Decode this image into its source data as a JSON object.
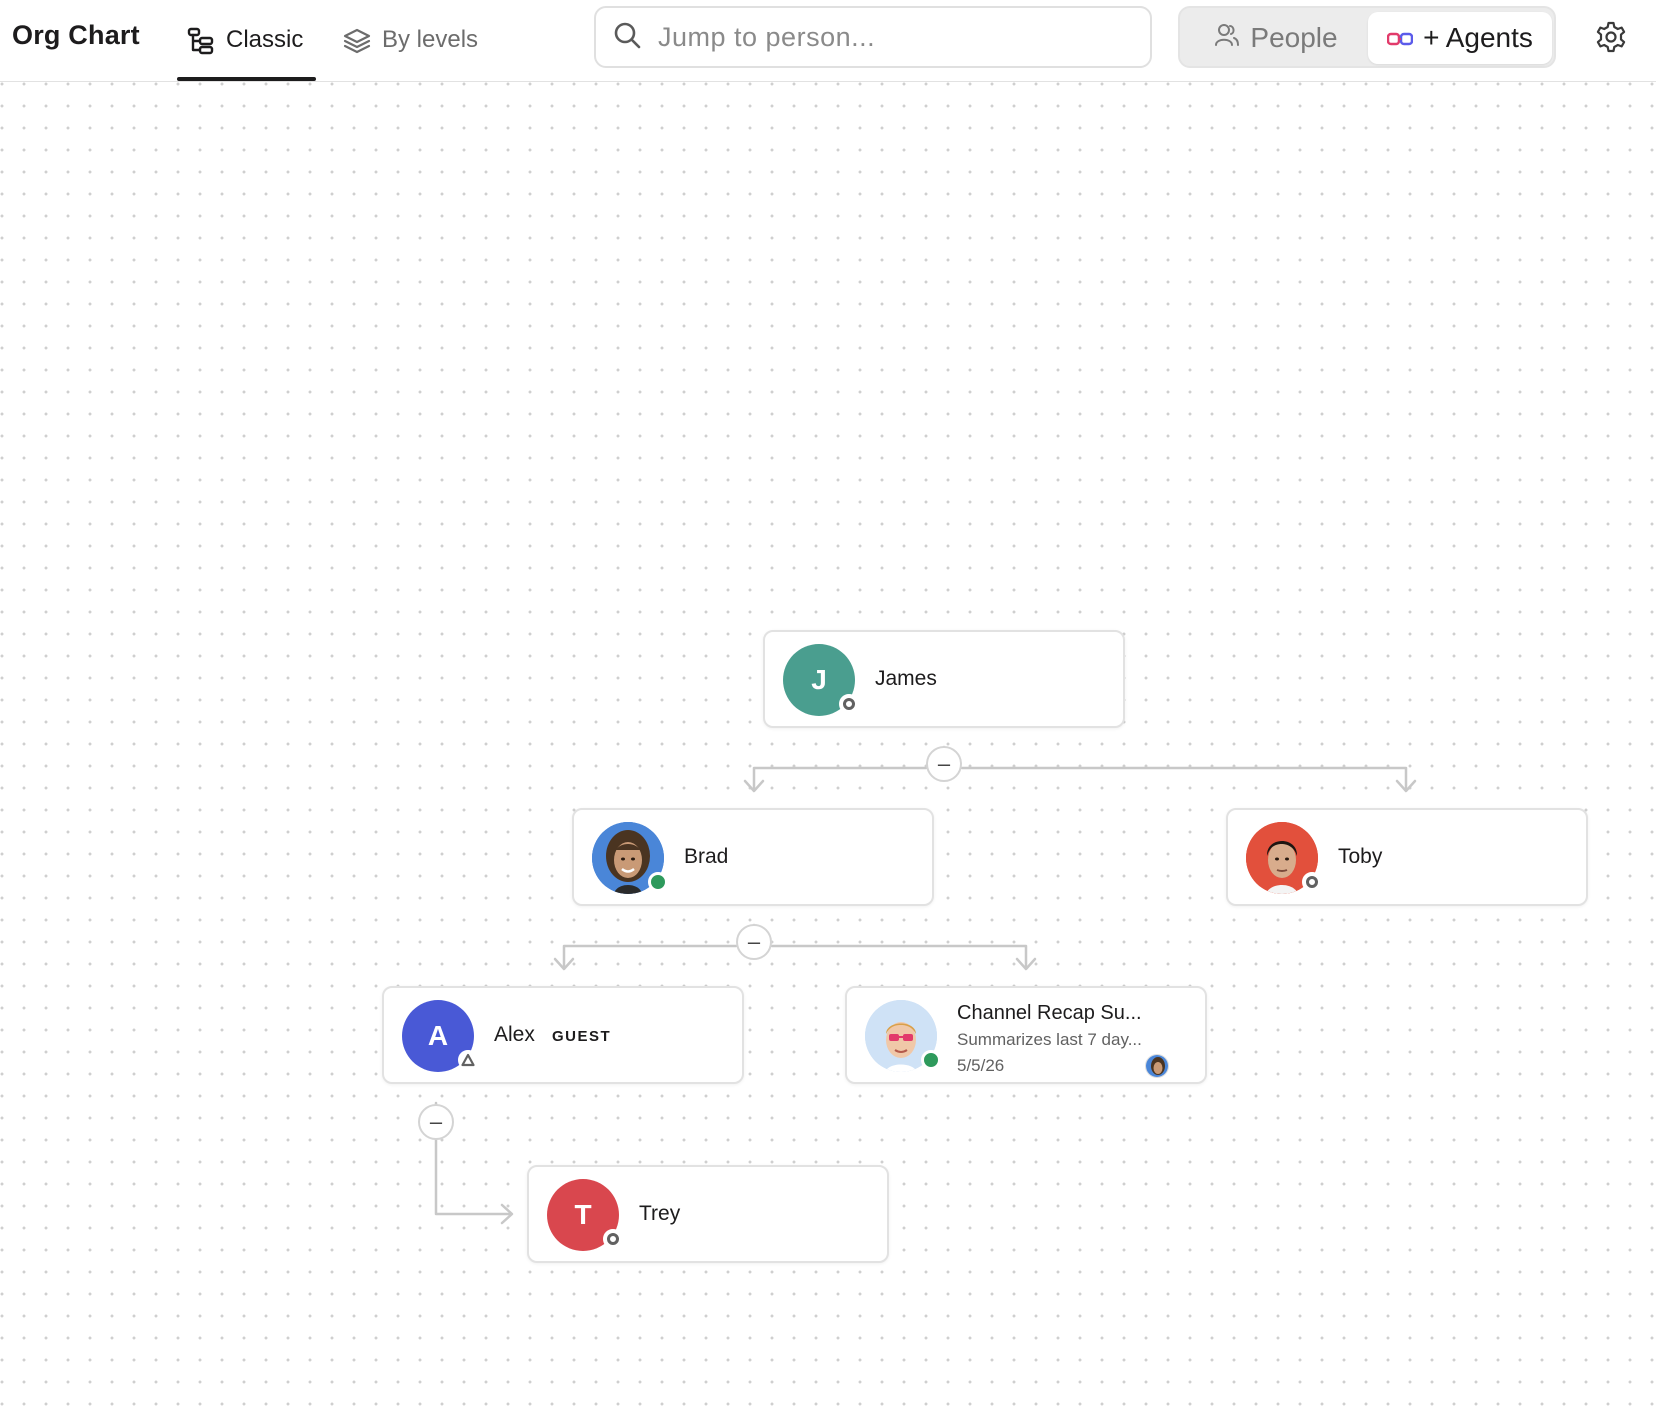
{
  "header": {
    "title": "Org Chart",
    "tabs": [
      {
        "label": "Classic",
        "active": true,
        "icon": "tree-icon"
      },
      {
        "label": "By levels",
        "active": false,
        "icon": "layers-icon"
      }
    ],
    "search": {
      "placeholder": "Jump to person...",
      "value": ""
    },
    "toggle": {
      "people_label": "People",
      "agents_label": "+ Agents",
      "selected": "+ Agents"
    },
    "settings_icon": "gear-icon"
  },
  "colors": {
    "james": "#4a9e8f",
    "alex": "#4959d6",
    "trey": "#d9474e",
    "online": "#2e9a5c",
    "edge": "#c8c8c8"
  },
  "nodes": {
    "james": {
      "name": "James",
      "initial": "J",
      "status": "away"
    },
    "brad": {
      "name": "Brad",
      "status": "online"
    },
    "toby": {
      "name": "Toby",
      "status": "away"
    },
    "alex": {
      "name": "Alex",
      "initial": "A",
      "tag": "GUEST",
      "status": "guest"
    },
    "agent": {
      "name": "Channel Recap Su...",
      "description": "Summarizes last 7 day...",
      "date": "5/5/26",
      "status": "online"
    },
    "trey": {
      "name": "Trey",
      "initial": "T",
      "status": "away"
    }
  },
  "collapse_label": "–"
}
